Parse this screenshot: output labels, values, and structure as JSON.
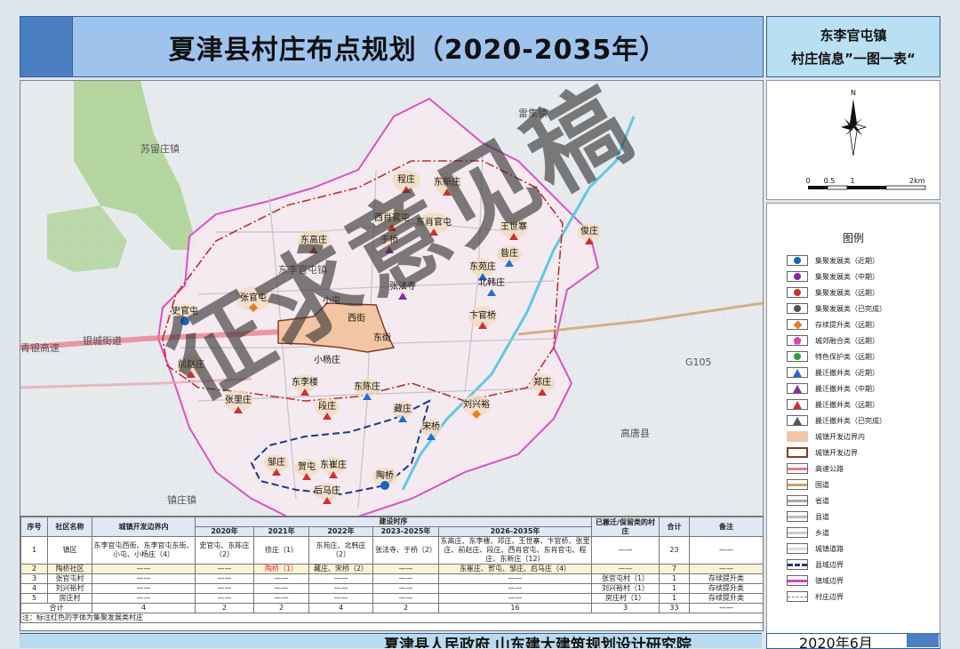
{
  "header": {
    "title": "夏津县村庄布点规划（2020-2035年）",
    "town": "东李官屯镇",
    "subtitle": "村庄信息”一图一表“"
  },
  "compass": {
    "north": "N",
    "scale": [
      "0",
      "0.5",
      "1",
      "2km"
    ]
  },
  "map": {
    "regions": [
      {
        "name": "雷集镇"
      },
      {
        "name": "苏留庄镇"
      },
      {
        "name": "银城街道"
      },
      {
        "name": "青银高速"
      },
      {
        "name": "G105"
      },
      {
        "name": "高唐县"
      },
      {
        "name": "东李官屯镇"
      },
      {
        "name": "镇庄镇"
      }
    ],
    "villages": [
      {
        "name": "程庄",
        "type": "red-tri"
      },
      {
        "name": "东新庄",
        "type": "red-tri"
      },
      {
        "name": "西肖官屯",
        "type": "red-tri"
      },
      {
        "name": "东肖官屯",
        "type": "red-tri"
      },
      {
        "name": "东高庄",
        "type": "red-tri"
      },
      {
        "name": "于桥",
        "type": "purple-tri"
      },
      {
        "name": "王世寨",
        "type": "red-tri"
      },
      {
        "name": "俊庄",
        "type": "red-tri"
      },
      {
        "name": "昝庄",
        "type": "blue-tri"
      },
      {
        "name": "东苑庄",
        "type": "blue-tri"
      },
      {
        "name": "北韩庄",
        "type": "blue-tri"
      },
      {
        "name": "张法寺",
        "type": "purple-tri"
      },
      {
        "name": "张官屯",
        "type": "orange-dia"
      },
      {
        "name": "小屯",
        "type": "none"
      },
      {
        "name": "西街",
        "type": "none"
      },
      {
        "name": "东街",
        "type": "none"
      },
      {
        "name": "卞官桥",
        "type": "red-tri"
      },
      {
        "name": "史官屯",
        "type": "blue-circ"
      },
      {
        "name": "前赵庄",
        "type": "red-tri"
      },
      {
        "name": "小杨庄",
        "type": "none"
      },
      {
        "name": "东李楼",
        "type": "red-tri"
      },
      {
        "name": "东陈庄",
        "type": "blue-tri"
      },
      {
        "name": "张里庄",
        "type": "red-tri"
      },
      {
        "name": "段庄",
        "type": "red-tri"
      },
      {
        "name": "藏庄",
        "type": "blue-tri"
      },
      {
        "name": "宋桥",
        "type": "blue-tri"
      },
      {
        "name": "刘兴裕",
        "type": "orange-dia"
      },
      {
        "name": "郑庄",
        "type": "red-tri"
      },
      {
        "name": "邹庄",
        "type": "red-tri"
      },
      {
        "name": "贺屯",
        "type": "red-tri"
      },
      {
        "name": "东崔庄",
        "type": "red-tri"
      },
      {
        "name": "后马庄",
        "type": "red-tri"
      },
      {
        "name": "陶桥",
        "type": "blue-circ"
      }
    ]
  },
  "legend": {
    "title": "图例",
    "items": [
      {
        "label": "集聚发展类（近期）",
        "sym": "circ",
        "color": "#1565c0"
      },
      {
        "label": "集聚发展类（中期）",
        "sym": "circ",
        "color": "#8e24aa"
      },
      {
        "label": "集聚发展类（远期）",
        "sym": "circ",
        "color": "#d32f2f"
      },
      {
        "label": "集聚发展类（已完成）",
        "sym": "circ",
        "color": "#555555"
      },
      {
        "label": "存续提升类（远期）",
        "sym": "dia",
        "color": "#e67e22"
      },
      {
        "label": "城郊融合类（远期）",
        "sym": "pent",
        "color": "#e040c0"
      },
      {
        "label": "特色保护类（远期）",
        "sym": "circ",
        "color": "#2e9e3e"
      },
      {
        "label": "搬迁撤并类（近期）",
        "sym": "tri",
        "color": "#1e6fd8"
      },
      {
        "label": "搬迁撤并类（中期）",
        "sym": "tri",
        "color": "#8e24aa"
      },
      {
        "label": "搬迁撤并类（远期）",
        "sym": "tri",
        "color": "#d32f2f"
      },
      {
        "label": "搬迁撤并类（已完成）",
        "sym": "tri",
        "color": "#555555"
      },
      {
        "label": "城镇开发边界内",
        "sym": "fill",
        "color": "#f2c6a4"
      },
      {
        "label": "城镇开发边界",
        "sym": "rect",
        "color": "#8b3a1e"
      },
      {
        "label": "高速公路",
        "sym": "hl",
        "color": "#e87a8a"
      },
      {
        "label": "国道",
        "sym": "hl",
        "color": "#c9a36a"
      },
      {
        "label": "省道",
        "sym": "hl",
        "color": "#aaaaaa"
      },
      {
        "label": "县道",
        "sym": "hl",
        "color": "#bbbbbb"
      },
      {
        "label": "乡道",
        "sym": "hl",
        "color": "#cccccc"
      },
      {
        "label": "城镇道路",
        "sym": "hl",
        "color": "#dddddd"
      },
      {
        "label": "县域边界",
        "sym": "dash",
        "color": "#1a3a8a"
      },
      {
        "label": "镇域边界",
        "sym": "hl",
        "color": "#e040c0"
      },
      {
        "label": "村庄边界",
        "sym": "dashthin",
        "color": "#888888"
      }
    ]
  },
  "table": {
    "head": {
      "no": "序号",
      "community": "社区名称",
      "boundary": "城镇开发边界内",
      "period": "建设时序",
      "y2020": "2020年",
      "y2021": "2021年",
      "y2022": "2022年",
      "y2023": "2023-2025年",
      "y2026": "2026-2035年",
      "moved": "已搬迁/保留类的村庄",
      "total": "合计",
      "note": "备注"
    },
    "rows": [
      {
        "no": "1",
        "name": "镇区",
        "boundary": "东李官屯西街、东李官屯东街、小屯、小杨庄（4）",
        "y2020": "史官屯、东陈庄（2）",
        "y2021": "徐庄（1）",
        "y2022": "东苑庄、北韩庄（2）",
        "y2023": "张法寺、于桥（2）",
        "y2026": "东高庄、东李楼、邓庄、王世寨、卞官桥、张里庄、前赵庄、段庄、西肖官屯、东肖官屯、程庄、东新庄（12）",
        "moved": "——",
        "total": "23",
        "note": "——"
      },
      {
        "no": "2",
        "name": "陶桥社区",
        "boundary": "——",
        "y2020": "——",
        "y2021": "陶桥（1）",
        "y2022": "藏庄、宋桥（2）",
        "y2023": "——",
        "y2026": "东崔庄、贺屯、邹庄、后马庄（4）",
        "moved": "——",
        "total": "7",
        "note": "——"
      },
      {
        "no": "3",
        "name": "张官屯村",
        "boundary": "——",
        "y2020": "——",
        "y2021": "——",
        "y2022": "——",
        "y2023": "——",
        "y2026": "——",
        "moved": "张官屯村（1）",
        "total": "1",
        "note": "存续提升类"
      },
      {
        "no": "4",
        "name": "刘兴裕村",
        "boundary": "——",
        "y2020": "——",
        "y2021": "——",
        "y2022": "——",
        "y2023": "——",
        "y2026": "——",
        "moved": "刘兴裕村（1）",
        "total": "1",
        "note": "存续提升类"
      },
      {
        "no": "5",
        "name": "房庄村",
        "boundary": "——",
        "y2020": "——",
        "y2021": "——",
        "y2022": "——",
        "y2023": "——",
        "y2026": "——",
        "moved": "房庄村（1）",
        "total": "1",
        "note": "存续提升类"
      }
    ],
    "sum": {
      "label": "合计",
      "boundary": "4",
      "y2020": "2",
      "y2021": "2",
      "y2022": "4",
      "y2023": "2",
      "y2026": "16",
      "moved": "3",
      "total": "33",
      "note": "——"
    },
    "footnote": "注：标注红色的字体为集聚发展类村庄"
  },
  "footer": {
    "institute": "夏津县人民政府  山东建大建筑规划设计研究院",
    "date": "2020年6月"
  },
  "watermark": "征求意见稿"
}
